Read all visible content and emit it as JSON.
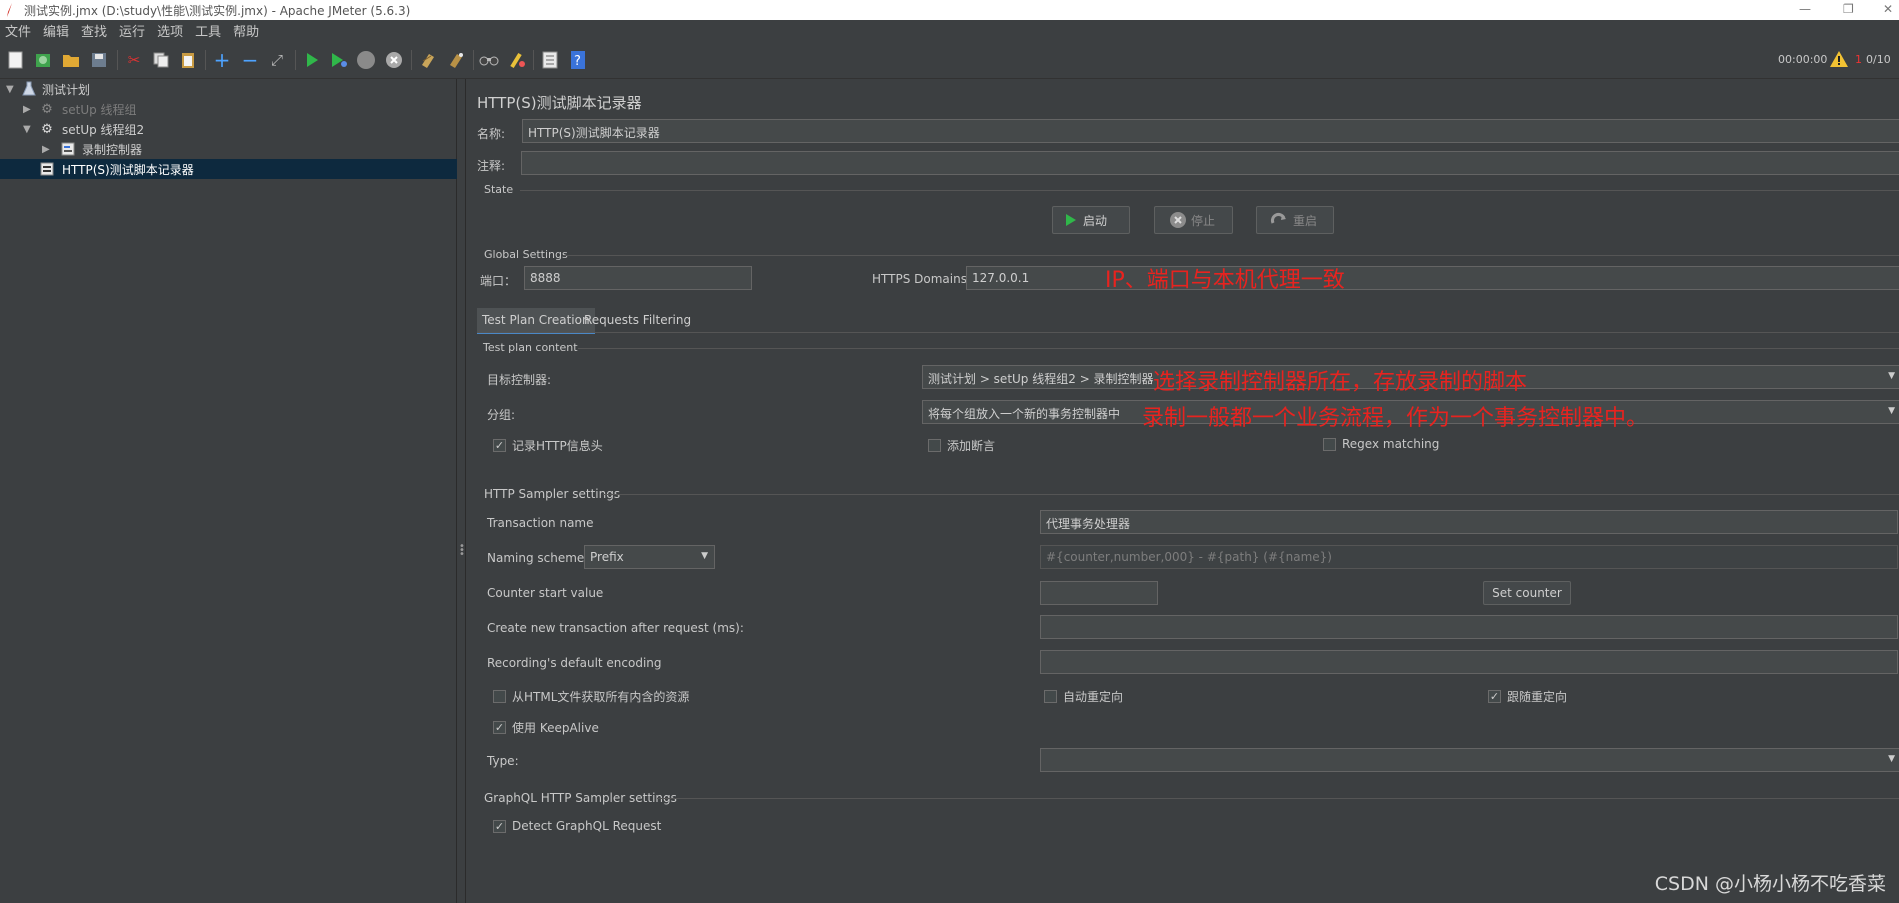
{
  "window": {
    "title": "测试实例.jmx (D:\\study\\性能\\测试实例.jmx) - Apache JMeter (5.6.3)",
    "minimize": "—",
    "restore": "❐",
    "close": "✕"
  },
  "menu": [
    "文件",
    "编辑",
    "查找",
    "运行",
    "选项",
    "工具",
    "帮助"
  ],
  "toolbar": {
    "timer": "00:00:00",
    "warn_count": "1",
    "threads": "0/10"
  },
  "tree": {
    "root": "测试计划",
    "setup1": "setUp 线程组",
    "setup2": "setUp 线程组2",
    "recording_controller": "录制控制器",
    "recorder": "HTTP(S)测试脚本记录器"
  },
  "panel": {
    "title": "HTTP(S)测试脚本记录器",
    "name_label": "名称:",
    "name_value": "HTTP(S)测试脚本记录器",
    "comment_label": "注释:",
    "comment_value": "",
    "state_label": "State",
    "start": "启动",
    "stop": "停止",
    "restart": "重启",
    "global_label": "Global Settings",
    "port_label": "端口：",
    "port_value": "8888",
    "https_label": "HTTPS Domains:",
    "https_value": "127.0.0.1",
    "tab_creation": "Test Plan Creation",
    "tab_filtering": "Requests Filtering",
    "content_label": "Test plan content",
    "target_label": "目标控制器:",
    "target_value": "测试计划 > setUp 线程组2 > 录制控制器",
    "group_label": "分组:",
    "group_value": "将每个组放入一个新的事务控制器中",
    "record_headers": "记录HTTP信息头",
    "add_assertion": "添加断言",
    "regex_matching": "Regex matching",
    "sampler_label": "HTTP Sampler settings",
    "transaction_label": "Transaction name",
    "transaction_value": "代理事务处理器",
    "naming_label": "Naming scheme",
    "naming_value": "Prefix",
    "naming_placeholder": "#{counter,number,000} - #{path} (#{name})",
    "counter_label": "Counter start value",
    "counter_value": "",
    "set_counter": "Set counter",
    "new_tx_label": "Create new transaction after request (ms):",
    "encoding_label": "Recording's default encoding",
    "retrieve_resources": "从HTML文件获取所有内含的资源",
    "auto_redirect": "自动重定向",
    "follow_redirect": "跟随重定向",
    "keepalive": "使用 KeepAlive",
    "type_label": "Type:",
    "graphql_label": "GraphQL HTTP Sampler settings",
    "detect_graphql": "Detect GraphQL Request"
  },
  "checks": {
    "record_headers": true,
    "add_assertion": false,
    "regex_matching": false,
    "retrieve_resources": false,
    "auto_redirect": false,
    "follow_redirect": true,
    "keepalive": true,
    "detect_graphql": true
  },
  "annotations": {
    "ip_port": "IP、端口与本机代理一致",
    "target_note": "选择录制控制器所在，存放录制的脚本",
    "group_note": "录制一般都一个业务流程，作为一个事务控制器中。"
  },
  "watermark": "CSDN @小杨小杨不吃香菜",
  "colors": {
    "background": "#3c3f41",
    "annotation": "#e8231f",
    "selection": "#0d293e"
  }
}
